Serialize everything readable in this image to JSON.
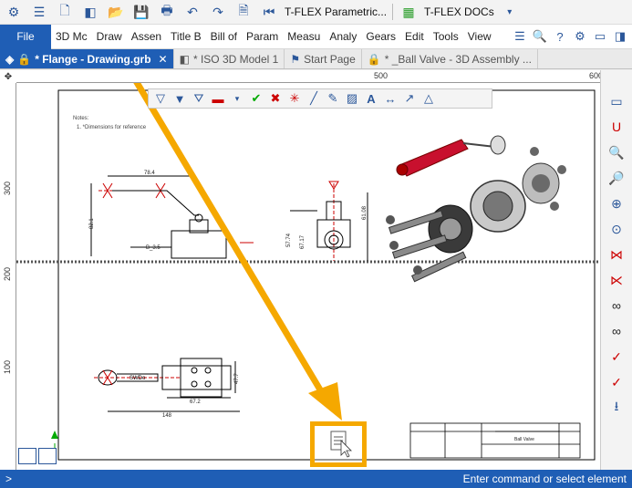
{
  "titlebar": {
    "app_title": "T-FLEX Parametric...",
    "docs_title": "T-FLEX DOCs"
  },
  "menubar": {
    "file": "File",
    "items": [
      "3D Mc",
      "Draw",
      "Assen",
      "Title B",
      "Bill of",
      "Param",
      "Measu",
      "Analy",
      "Gears",
      "Edit",
      "Tools",
      "View"
    ]
  },
  "tabs": [
    {
      "label": "* Flange - Drawing.grb",
      "active": true
    },
    {
      "label": "* ISO 3D Model 1",
      "active": false
    },
    {
      "label": "Start Page",
      "active": false
    },
    {
      "label": "* _Ball Valve - 3D Assembly ...",
      "active": false
    }
  ],
  "ruler": {
    "top_left": "500",
    "top_right": "600",
    "left_marks": [
      "300",
      "200",
      "100"
    ]
  },
  "drawing": {
    "notes_title": "Notes:",
    "notes_line": "1. *Dimensions for reference",
    "dim_top": "78.4",
    "dim_left": "82.1",
    "dim_side": "61.08",
    "dim_vert1": "57.74",
    "dim_vert2": "67.17",
    "dim_b": "B_3.5",
    "dim_bottom1": "67.2",
    "dim_bottom2": "148",
    "dim_right": "47.7",
    "stamp_title": "Ball Valve"
  },
  "statusbar": {
    "prompt": ">",
    "message": "Enter command or select element"
  },
  "colors": {
    "accent": "#1f5eb5",
    "highlight": "#f5a800",
    "handle_red": "#c8102e"
  }
}
